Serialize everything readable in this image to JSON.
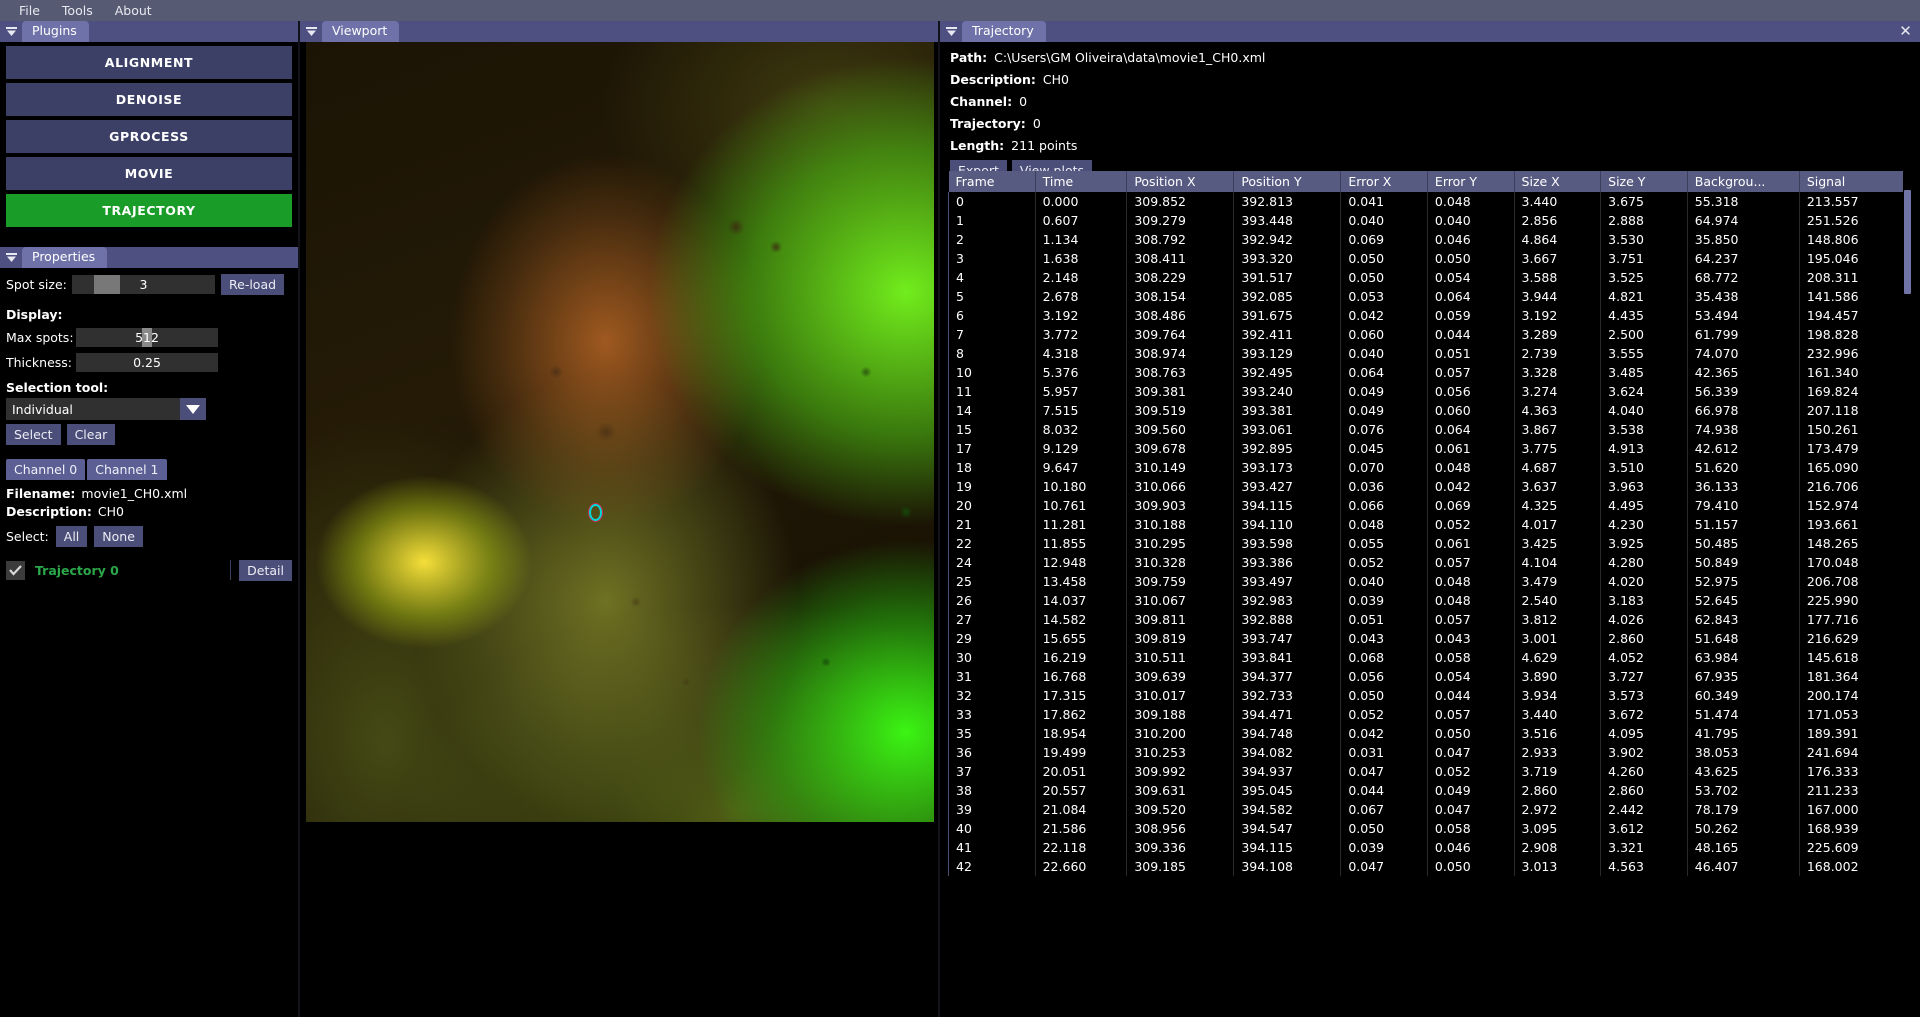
{
  "menubar": {
    "items": [
      "File",
      "Tools",
      "About"
    ]
  },
  "panels": {
    "plugins": {
      "title": "Plugins"
    },
    "properties": {
      "title": "Properties"
    },
    "viewport": {
      "title": "Viewport"
    },
    "trajectory": {
      "title": "Trajectory",
      "close_glyph": "✕"
    }
  },
  "plugins": {
    "buttons": [
      {
        "label": "ALIGNMENT",
        "active": false
      },
      {
        "label": "DENOISE",
        "active": false
      },
      {
        "label": "GPROCESS",
        "active": false
      },
      {
        "label": "MOVIE",
        "active": false
      },
      {
        "label": "TRAJECTORY",
        "active": true
      }
    ],
    "active_color": "#1a9d28"
  },
  "properties": {
    "spot_size_label": "Spot size:",
    "spot_size_value": "3",
    "reload_label": "Re-load",
    "display_label": "Display:",
    "max_spots_label": "Max spots:",
    "max_spots_value": "512",
    "thickness_label": "Thickness:",
    "thickness_value": "0.25",
    "selection_tool_label": "Selection tool:",
    "selection_tool_value": "Individual",
    "select_button": "Select",
    "clear_button": "Clear",
    "channel_tabs": [
      "Channel 0",
      "Channel 1"
    ],
    "filename_label": "Filename:",
    "filename_value": "movie1_CH0.xml",
    "description_label": "Description:",
    "description_value": "CH0",
    "select_label": "Select:",
    "select_all": "All",
    "select_none": "None",
    "trajectory_item": {
      "name": "Trajectory 0",
      "checked": true,
      "detail_label": "Detail",
      "color": "#2aa84a"
    }
  },
  "trajectory_info": {
    "path_label": "Path:",
    "path_value": "C:\\Users\\GM Oliveira\\data\\movie1_CH0.xml",
    "description_label": "Description:",
    "description_value": "CH0",
    "channel_label": "Channel:",
    "channel_value": "0",
    "trajectory_label": "Trajectory:",
    "trajectory_value": "0",
    "length_label": "Length:",
    "length_value": "211 points",
    "export_label": "Export",
    "view_plots_label": "View plots"
  },
  "table": {
    "columns": [
      "Frame",
      "Time",
      "Position X",
      "Position Y",
      "Error X",
      "Error Y",
      "Size X",
      "Size Y",
      "Backgrou...",
      "Signal"
    ],
    "rows": [
      [
        "0",
        "0.000",
        "309.852",
        "392.813",
        "0.041",
        "0.048",
        "3.440",
        "3.675",
        "55.318",
        "213.557"
      ],
      [
        "1",
        "0.607",
        "309.279",
        "393.448",
        "0.040",
        "0.040",
        "2.856",
        "2.888",
        "64.974",
        "251.526"
      ],
      [
        "2",
        "1.134",
        "308.792",
        "392.942",
        "0.069",
        "0.046",
        "4.864",
        "3.530",
        "35.850",
        "148.806"
      ],
      [
        "3",
        "1.638",
        "308.411",
        "393.320",
        "0.050",
        "0.050",
        "3.667",
        "3.751",
        "64.237",
        "195.046"
      ],
      [
        "4",
        "2.148",
        "308.229",
        "391.517",
        "0.050",
        "0.054",
        "3.588",
        "3.525",
        "68.772",
        "208.311"
      ],
      [
        "5",
        "2.678",
        "308.154",
        "392.085",
        "0.053",
        "0.064",
        "3.944",
        "4.821",
        "35.438",
        "141.586"
      ],
      [
        "6",
        "3.192",
        "308.486",
        "391.675",
        "0.042",
        "0.059",
        "3.192",
        "4.435",
        "53.494",
        "194.457"
      ],
      [
        "7",
        "3.772",
        "309.764",
        "392.411",
        "0.060",
        "0.044",
        "3.289",
        "2.500",
        "61.799",
        "198.828"
      ],
      [
        "8",
        "4.318",
        "308.974",
        "393.129",
        "0.040",
        "0.051",
        "2.739",
        "3.555",
        "74.070",
        "232.996"
      ],
      [
        "10",
        "5.376",
        "308.763",
        "392.495",
        "0.064",
        "0.057",
        "3.328",
        "3.485",
        "42.365",
        "161.340"
      ],
      [
        "11",
        "5.957",
        "309.381",
        "393.240",
        "0.049",
        "0.056",
        "3.274",
        "3.624",
        "56.339",
        "169.824"
      ],
      [
        "14",
        "7.515",
        "309.519",
        "393.381",
        "0.049",
        "0.060",
        "4.363",
        "4.040",
        "66.978",
        "207.118"
      ],
      [
        "15",
        "8.032",
        "309.560",
        "393.061",
        "0.076",
        "0.064",
        "3.867",
        "3.538",
        "74.938",
        "150.261"
      ],
      [
        "17",
        "9.129",
        "309.678",
        "392.895",
        "0.045",
        "0.061",
        "3.775",
        "4.913",
        "42.612",
        "173.479"
      ],
      [
        "18",
        "9.647",
        "310.149",
        "393.173",
        "0.070",
        "0.048",
        "4.687",
        "3.510",
        "51.620",
        "165.090"
      ],
      [
        "19",
        "10.180",
        "310.066",
        "393.427",
        "0.036",
        "0.042",
        "3.637",
        "3.963",
        "36.133",
        "216.706"
      ],
      [
        "20",
        "10.761",
        "309.903",
        "394.115",
        "0.066",
        "0.069",
        "4.325",
        "4.495",
        "79.410",
        "152.974"
      ],
      [
        "21",
        "11.281",
        "310.188",
        "394.110",
        "0.048",
        "0.052",
        "4.017",
        "4.230",
        "51.157",
        "193.661"
      ],
      [
        "22",
        "11.855",
        "310.295",
        "393.598",
        "0.055",
        "0.061",
        "3.425",
        "3.925",
        "50.485",
        "148.265"
      ],
      [
        "24",
        "12.948",
        "310.328",
        "393.386",
        "0.052",
        "0.057",
        "4.104",
        "4.280",
        "50.849",
        "170.048"
      ],
      [
        "25",
        "13.458",
        "309.759",
        "393.497",
        "0.040",
        "0.048",
        "3.479",
        "4.020",
        "52.975",
        "206.708"
      ],
      [
        "26",
        "14.037",
        "310.067",
        "392.983",
        "0.039",
        "0.048",
        "2.540",
        "3.183",
        "52.645",
        "225.990"
      ],
      [
        "27",
        "14.582",
        "309.811",
        "392.888",
        "0.051",
        "0.057",
        "3.812",
        "4.026",
        "62.843",
        "177.716"
      ],
      [
        "29",
        "15.655",
        "309.819",
        "393.747",
        "0.043",
        "0.043",
        "3.001",
        "2.860",
        "51.648",
        "216.629"
      ],
      [
        "30",
        "16.219",
        "310.511",
        "393.841",
        "0.068",
        "0.058",
        "4.629",
        "4.052",
        "63.984",
        "145.618"
      ],
      [
        "31",
        "16.768",
        "309.639",
        "394.377",
        "0.056",
        "0.054",
        "3.890",
        "3.727",
        "67.935",
        "181.364"
      ],
      [
        "32",
        "17.315",
        "310.017",
        "392.733",
        "0.050",
        "0.044",
        "3.934",
        "3.573",
        "60.349",
        "200.174"
      ],
      [
        "33",
        "17.862",
        "309.188",
        "394.471",
        "0.052",
        "0.057",
        "3.440",
        "3.672",
        "51.474",
        "171.053"
      ],
      [
        "35",
        "18.954",
        "310.200",
        "394.748",
        "0.042",
        "0.050",
        "3.516",
        "4.095",
        "41.795",
        "189.391"
      ],
      [
        "36",
        "19.499",
        "310.253",
        "394.082",
        "0.031",
        "0.047",
        "2.933",
        "3.902",
        "38.053",
        "241.694"
      ],
      [
        "37",
        "20.051",
        "309.992",
        "394.937",
        "0.047",
        "0.052",
        "3.719",
        "4.260",
        "43.625",
        "176.333"
      ],
      [
        "38",
        "20.557",
        "309.631",
        "395.045",
        "0.044",
        "0.049",
        "2.860",
        "2.860",
        "53.702",
        "211.233"
      ],
      [
        "39",
        "21.084",
        "309.520",
        "394.582",
        "0.067",
        "0.047",
        "2.972",
        "2.442",
        "78.179",
        "167.000"
      ],
      [
        "40",
        "21.586",
        "308.956",
        "394.547",
        "0.050",
        "0.058",
        "3.095",
        "3.612",
        "50.262",
        "168.939"
      ],
      [
        "41",
        "22.118",
        "309.336",
        "394.115",
        "0.039",
        "0.046",
        "2.908",
        "3.321",
        "48.165",
        "225.609"
      ],
      [
        "42",
        "22.660",
        "309.185",
        "394.108",
        "0.047",
        "0.050",
        "3.013",
        "4.563",
        "46.407",
        "168.002"
      ]
    ]
  },
  "viewport": {
    "marker_label": "selected-spot-marker",
    "marker_color": "#00d8d8"
  },
  "colors": {
    "panel_header": "#4d5080",
    "tab_active": "#6f72a8",
    "button": "#3c4066",
    "accent_green": "#1a9d28",
    "table_header": "#575b82"
  }
}
